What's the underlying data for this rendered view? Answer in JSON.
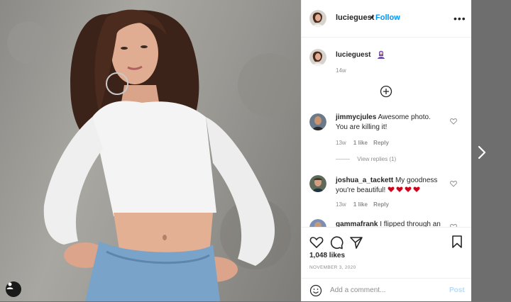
{
  "post": {
    "username": "lucieguest",
    "follow_label": "Follow",
    "dot": "•",
    "more_glyph": "•••"
  },
  "caption": {
    "username": "lucieguest",
    "time": "14w"
  },
  "comments": [
    {
      "username": "jimmycjules",
      "text": "Awesome photo. You are killing it!",
      "time": "13w",
      "likes": "1 like",
      "reply_label": "Reply",
      "view_replies": "View replies (1)"
    },
    {
      "username": "joshua_a_tackett",
      "text": "My goodness you're beautiful!",
      "time": "13w",
      "likes": "1 like",
      "reply_label": "Reply"
    },
    {
      "username": "gammafrank",
      "text": "I flipped through an"
    }
  ],
  "likes_text": "1,048 likes",
  "date_text": "NOVEMBER 3, 2020",
  "add_comment": {
    "placeholder": "Add a comment...",
    "post_label": "Post"
  },
  "colors": {
    "follow": "#0095f6",
    "post_disabled": "#b3dbff",
    "heart_emoji": "#d0021b"
  }
}
